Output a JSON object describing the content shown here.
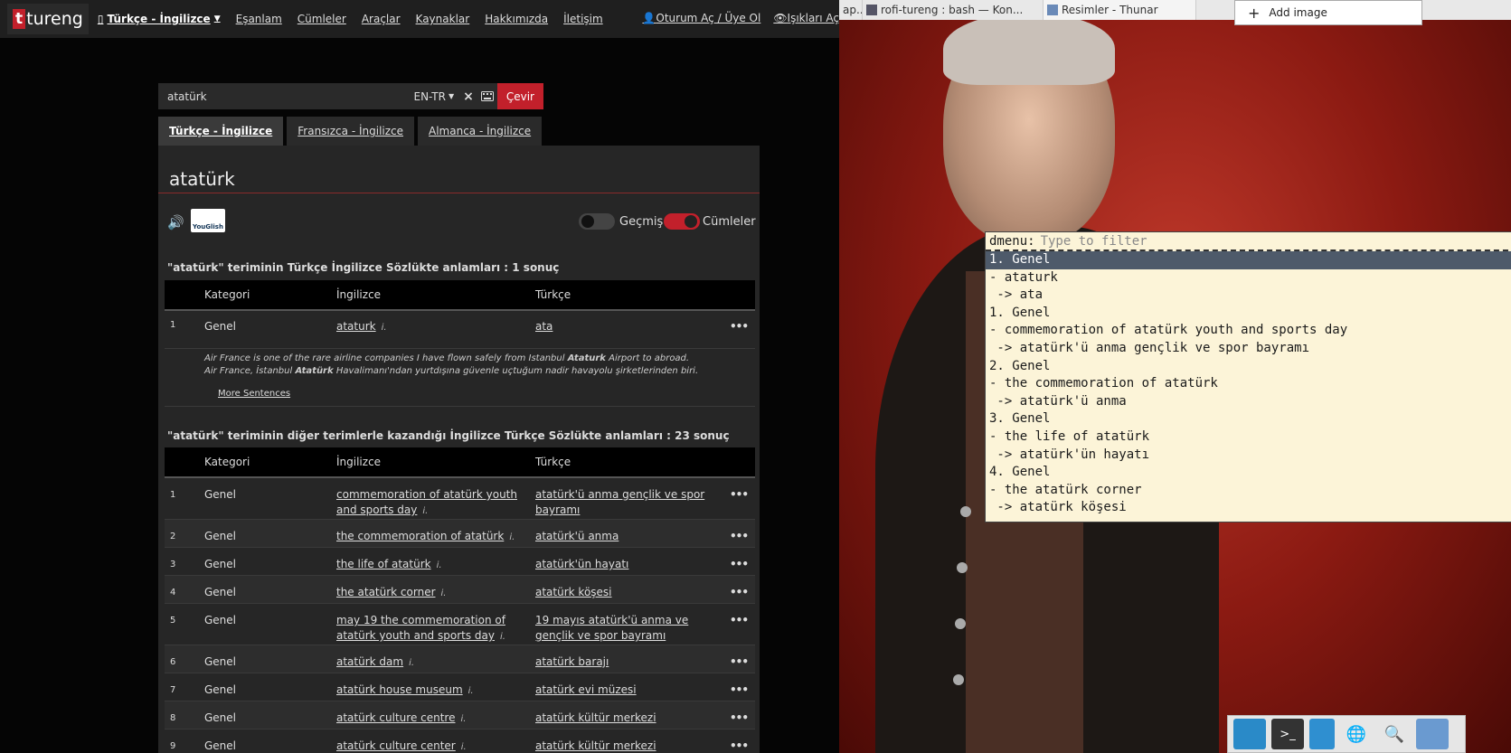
{
  "nav": {
    "logo_t": "t",
    "logo_rest": "tureng",
    "lang_dropdown": "Türkçe - İngilizce",
    "links": [
      "Eşanlam",
      "Cümleler",
      "Araçlar",
      "Kaynaklar",
      "Hakkımızda",
      "İletişim"
    ],
    "login": "Oturum Aç / Üye Ol",
    "lights": "Işıkları Aç"
  },
  "search": {
    "value": "atatürk",
    "direction": "EN-TR",
    "clear": "×",
    "submit": "Çevir"
  },
  "tabs": [
    "Türkçe - İngilizce",
    "Fransızca - İngilizce",
    "Almanca - İngilizce"
  ],
  "result": {
    "word": "atatürk",
    "youglish": "YouGlish",
    "toggle_history": "Geçmiş",
    "toggle_sentences": "Cümleler"
  },
  "section1": {
    "heading": "\"atatürk\" teriminin Türkçe İngilizce Sözlükte anlamları : 1 sonuç",
    "headers": [
      "Kategori",
      "İngilizce",
      "Türkçe"
    ],
    "rows": [
      {
        "num": "1",
        "cat": "Genel",
        "en": "ataturk",
        "abbr": "i.",
        "tr": "ata"
      }
    ],
    "example_en": "Air France is one of the rare airline companies I have flown safely from Istanbul Ataturk Airport to abroad.",
    "example_tr": "Air France, İstanbul Atatürk Havalimanı'ndan yurtdışına güvenle uçtuğum nadir havayolu şirketlerinden biri.",
    "more": "More Sentences"
  },
  "section2": {
    "heading": "\"atatürk\" teriminin diğer terimlerle kazandığı İngilizce Türkçe Sözlükte anlamları : 23 sonuç",
    "headers": [
      "Kategori",
      "İngilizce",
      "Türkçe"
    ],
    "rows": [
      {
        "num": "1",
        "cat": "Genel",
        "en": "commemoration of atatürk youth and sports day",
        "abbr": "i.",
        "tr": "atatürk'ü anma gençlik ve spor bayramı"
      },
      {
        "num": "2",
        "cat": "Genel",
        "en": "the commemoration of atatürk",
        "abbr": "i.",
        "tr": "atatürk'ü anma"
      },
      {
        "num": "3",
        "cat": "Genel",
        "en": "the life of atatürk",
        "abbr": "i.",
        "tr": "atatürk'ün hayatı"
      },
      {
        "num": "4",
        "cat": "Genel",
        "en": "the atatürk corner",
        "abbr": "i.",
        "tr": "atatürk köşesi"
      },
      {
        "num": "5",
        "cat": "Genel",
        "en": "may 19 the commemoration of atatürk youth and sports day",
        "abbr": "i.",
        "tr": "19 mayıs atatürk'ü anma ve gençlik ve spor bayramı"
      },
      {
        "num": "6",
        "cat": "Genel",
        "en": "atatürk dam",
        "abbr": "i.",
        "tr": "atatürk barajı"
      },
      {
        "num": "7",
        "cat": "Genel",
        "en": "atatürk house museum",
        "abbr": "i.",
        "tr": "atatürk evi müzesi"
      },
      {
        "num": "8",
        "cat": "Genel",
        "en": "atatürk culture centre",
        "abbr": "i.",
        "tr": "atatürk kültür merkezi"
      },
      {
        "num": "9",
        "cat": "Genel",
        "en": "atatürk culture center",
        "abbr": "i.",
        "tr": "atatürk kültür merkezi"
      }
    ]
  },
  "desktop": {
    "taskbar": [
      "ap...",
      "rofi-tureng : bash — Kon...",
      "Resimler - Thunar"
    ],
    "add_image": "Add image",
    "dmenu_prompt": "dmenu:",
    "dmenu_placeholder": "Type to filter",
    "dmenu_items": [
      "1. Genel",
      "- ataturk",
      " -> ata",
      "1. Genel",
      "- commemoration of atatürk youth and sports day",
      " -> atatürk'ü anma gençlik ve spor bayramı",
      "2. Genel",
      "- the commemoration of atatürk",
      " -> atatürk'ü anma",
      "3. Genel",
      "- the life of atatürk",
      " -> atatürk'ün hayatı",
      "4. Genel",
      "- the atatürk corner",
      " -> atatürk köşesi"
    ],
    "dmenu_selected_index": 0,
    "dock_icons": [
      "desktop-icon",
      "terminal-icon",
      "files-icon",
      "browser-icon",
      "search-icon",
      "folder-icon"
    ]
  },
  "colors": {
    "accent": "#c2202b",
    "dmenu_bg": "#fcf4d8",
    "dmenu_sel": "#4e5a6a"
  }
}
